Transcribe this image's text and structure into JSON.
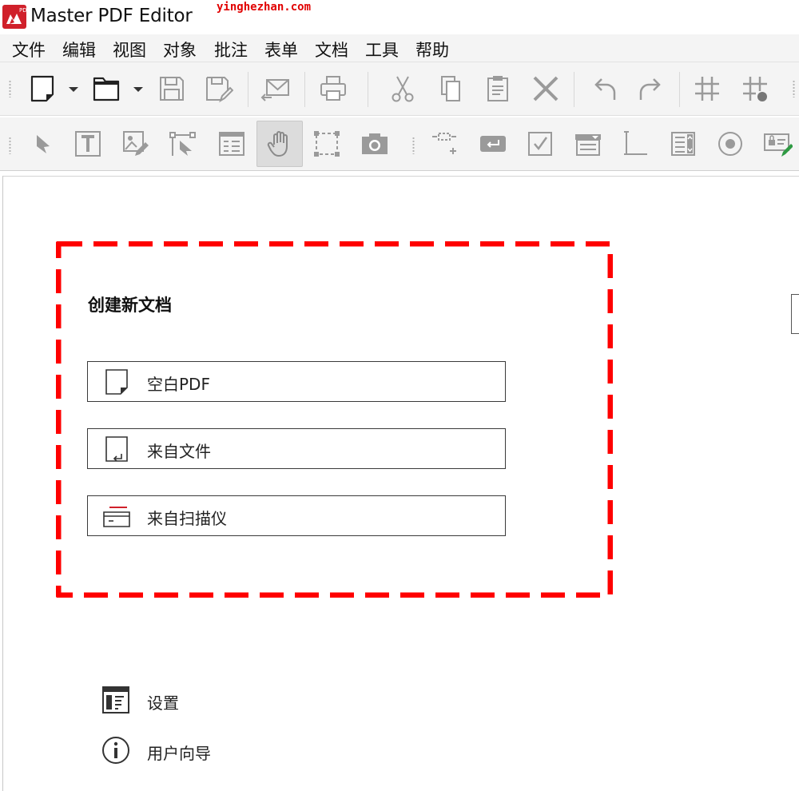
{
  "window": {
    "title": "Master PDF Editor",
    "logo_text": "PDF",
    "accent": "#d0202a"
  },
  "watermark": "yinghezhan.com",
  "menu": [
    "文件",
    "编辑",
    "视图",
    "对象",
    "批注",
    "表单",
    "文档",
    "工具",
    "帮助"
  ],
  "toolbar_main": {
    "icons": [
      "new-document-icon",
      "open-folder-icon",
      "save-icon",
      "save-as-icon",
      "email-icon",
      "print-icon",
      "cut-icon",
      "copy-icon",
      "paste-icon",
      "delete-icon",
      "undo-icon",
      "redo-icon",
      "grid-icon",
      "snap-to-grid-icon"
    ]
  },
  "toolbar_tools": {
    "icons": [
      "select-arrow-icon",
      "edit-text-icon",
      "edit-image-icon",
      "edit-shape-icon",
      "form-icon",
      "hand-tool-icon",
      "select-area-icon",
      "snapshot-icon",
      "link-icon",
      "button-field-icon",
      "checkbox-field-icon",
      "combobox-field-icon",
      "text-field-icon",
      "listbox-field-icon",
      "radio-field-icon",
      "signature-field-icon"
    ],
    "active": "hand-tool-icon"
  },
  "start": {
    "title": "创建新文档",
    "buttons": [
      {
        "label": "空白PDF",
        "icon": "blank-page-icon"
      },
      {
        "label": "来自文件",
        "icon": "page-from-file-icon"
      },
      {
        "label": "来自扫描仪",
        "icon": "scanner-icon"
      }
    ],
    "links": [
      {
        "label": "设置",
        "icon": "settings-window-icon"
      },
      {
        "label": "用户向导",
        "icon": "info-icon"
      }
    ]
  },
  "highlight_color": "#ff0000"
}
